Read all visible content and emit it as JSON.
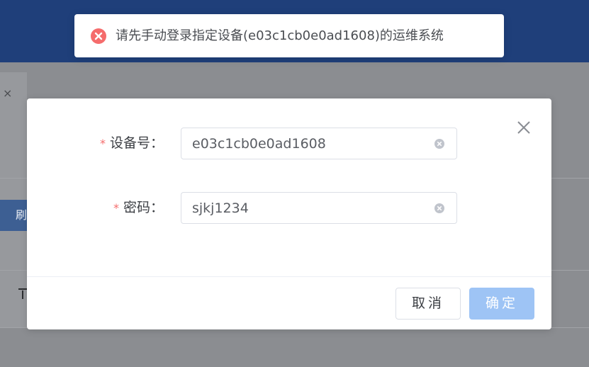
{
  "toast": {
    "icon": "error-circle-icon",
    "message": "请先手动登录指定设备(e03c1cb0e0ad1608)的运维系统",
    "color": "#f56c6c"
  },
  "background": {
    "tab_close": "×",
    "button_fragment": "刷"
  },
  "dialog": {
    "close_icon": "close-icon",
    "fields": [
      {
        "required_mark": "*",
        "label": "设备号：",
        "value": "e03c1cb0e0ad1608"
      },
      {
        "required_mark": "*",
        "label": "密码：",
        "value": "sjkj1234"
      }
    ],
    "cancel_label": "取消",
    "confirm_label": "确定",
    "accent_color": "#9ec4f5"
  }
}
